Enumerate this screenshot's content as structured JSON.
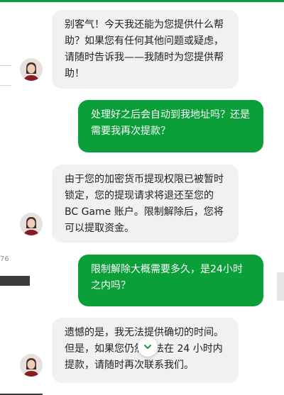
{
  "page_left_fragment": "76",
  "messages": [
    {
      "sender": "agent",
      "text": "别客气！今天我还能为您提供什么帮助？如果您有任何其他问题或疑虑，请随时告诉我——我随时为您提供帮助！"
    },
    {
      "sender": "user",
      "text": "处理好之后会自动到我地址吗？还是需要我再次提款？"
    },
    {
      "sender": "agent",
      "text": "由于您的加密货币提现权限已被暂时锁定，您的提现请求将退还至您的 BC Game 账户。限制解除后，您将可以提取资金。"
    },
    {
      "sender": "user",
      "text": "限制解除大概需要多久，是24小时之内吗？"
    },
    {
      "sender": "agent",
      "text": "遗憾的是，我无法提供确切的时间。但是，如果您仍然无法在 24 小时内提款，请随时再次联系我们。"
    }
  ],
  "icons": {
    "scroll_down": "chevron-down-icon",
    "avatar": "agent-avatar"
  },
  "colors": {
    "accent": "#0b9f3a",
    "agent_bubble": "#f1f1f1",
    "user_bubble": "#0b9f3a"
  }
}
